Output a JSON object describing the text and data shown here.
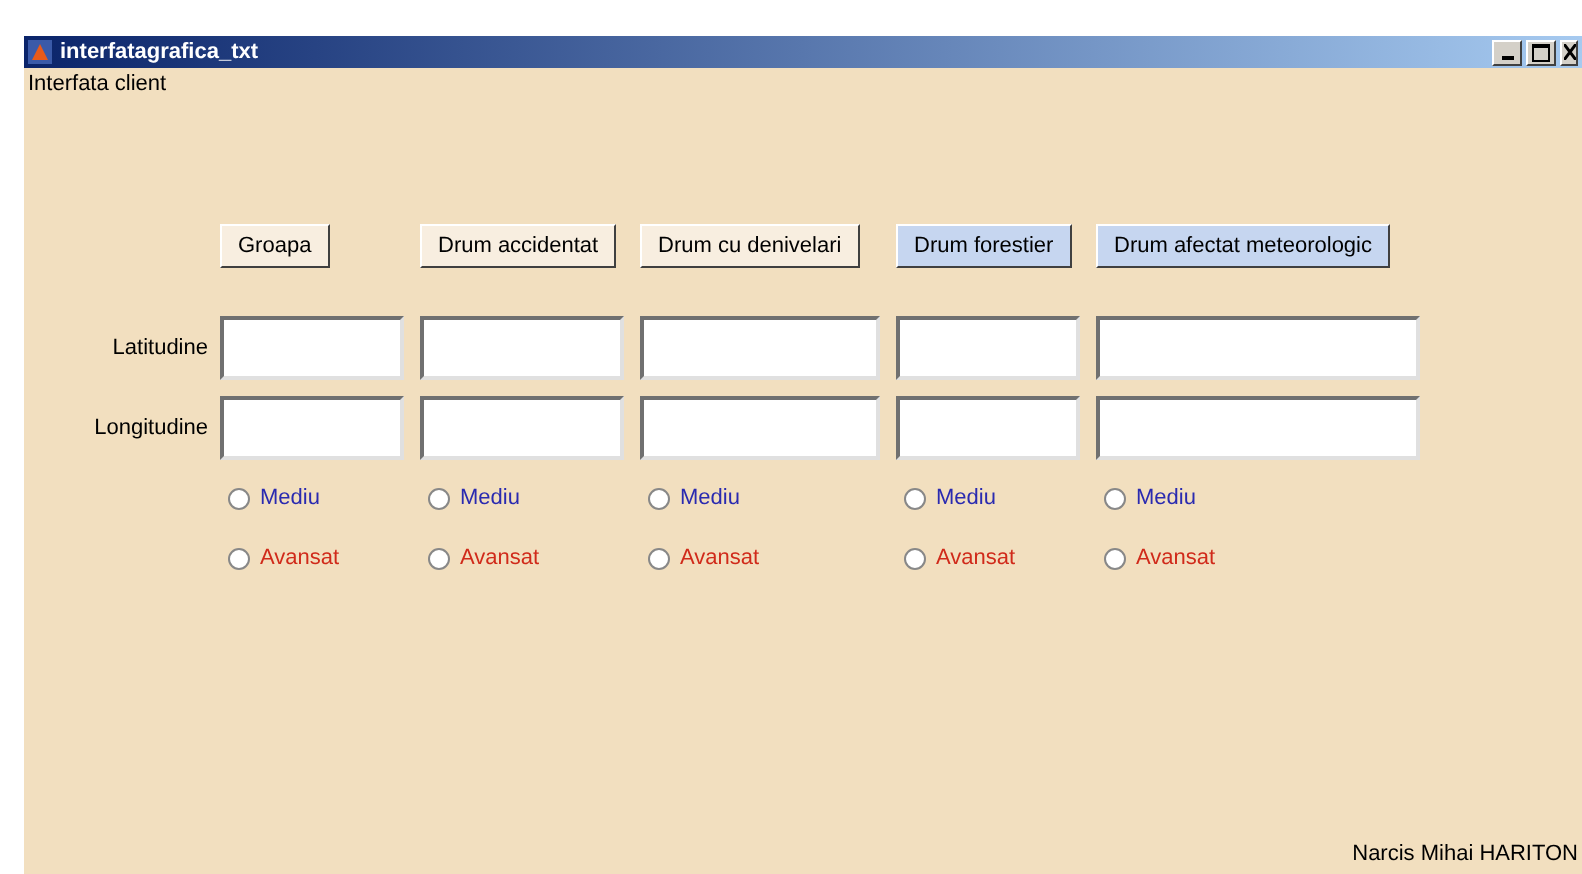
{
  "window": {
    "title": "interfatagrafica_txt"
  },
  "header": "Interfata client",
  "row_labels": [
    "Latitudine",
    "Longitudine"
  ],
  "columns": [
    {
      "button": {
        "label": "Groapa",
        "highlighted": false
      },
      "options": [
        {
          "label": "Mediu",
          "kind": "basic",
          "selected": false
        },
        {
          "label": "Avansat",
          "kind": "advanced",
          "selected": false
        }
      ]
    },
    {
      "button": {
        "label": "Drum accidentat",
        "highlighted": false
      },
      "options": [
        {
          "label": "Mediu",
          "kind": "basic",
          "selected": false
        },
        {
          "label": "Avansat",
          "kind": "advanced",
          "selected": false
        }
      ]
    },
    {
      "button": {
        "label": "Drum cu denivelari",
        "highlighted": false
      },
      "options": [
        {
          "label": "Mediu",
          "kind": "basic",
          "selected": false
        },
        {
          "label": "Avansat",
          "kind": "advanced",
          "selected": false
        }
      ]
    },
    {
      "button": {
        "label": "Drum forestier",
        "highlighted": true
      },
      "options": [
        {
          "label": "Mediu",
          "kind": "basic",
          "selected": false
        },
        {
          "label": "Avansat",
          "kind": "advanced",
          "selected": false
        }
      ]
    },
    {
      "button": {
        "label": "Drum afectat meteorologic",
        "highlighted": true
      },
      "options": [
        {
          "label": "Mediu",
          "kind": "basic",
          "selected": false
        },
        {
          "label": "Avansat",
          "kind": "advanced",
          "selected": false
        }
      ]
    }
  ],
  "author": "Narcis Mihai HARITON"
}
